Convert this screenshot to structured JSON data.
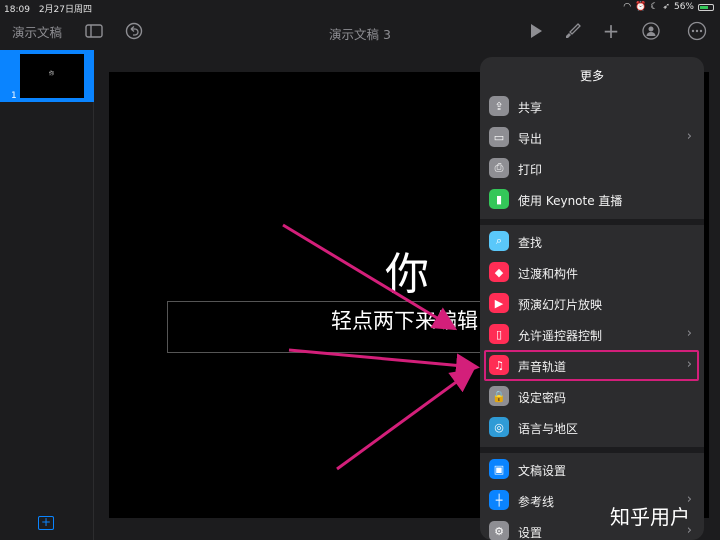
{
  "status_bar": {
    "time": "18:09",
    "date": "2月27日周四",
    "battery": "56%"
  },
  "toolbar": {
    "documents_label": "演示文稿",
    "title": "演示文稿 3"
  },
  "sidebar": {
    "slide_number": "1",
    "thumb_text": "你"
  },
  "slide": {
    "title": "你",
    "subtitle": "轻点两下来编辑"
  },
  "menu": {
    "title": "更多",
    "items": [
      {
        "label": "共享",
        "icon": "share-icon",
        "color": "#8e8e93",
        "glyph": "⇪"
      },
      {
        "label": "导出",
        "icon": "export-icon",
        "color": "#8e8e93",
        "glyph": "▭",
        "chevron": "›"
      },
      {
        "label": "打印",
        "icon": "print-icon",
        "color": "#8e8e93",
        "glyph": "⎙"
      },
      {
        "label": "使用 Keynote 直播",
        "icon": "keynote-live-icon",
        "color": "#34c759",
        "glyph": "▮"
      },
      {
        "label": "查找",
        "icon": "search-icon",
        "color": "#5ac8fa",
        "glyph": "⌕"
      },
      {
        "label": "过渡和构件",
        "icon": "transition-icon",
        "color": "#ff2d55",
        "glyph": "◆"
      },
      {
        "label": "预演幻灯片放映",
        "icon": "rehearse-icon",
        "color": "#ff2d55",
        "glyph": "▶"
      },
      {
        "label": "允许遥控器控制",
        "icon": "remote-icon",
        "color": "#ff2d55",
        "glyph": "▯",
        "chevron": "›"
      },
      {
        "label": "声音轨道",
        "icon": "music-icon",
        "color": "#ff2d55",
        "glyph": "♫",
        "chevron": "›"
      },
      {
        "label": "设定密码",
        "icon": "lock-icon",
        "color": "#8e8e93",
        "glyph": "🔒"
      },
      {
        "label": "语言与地区",
        "icon": "globe-icon",
        "color": "#2f9bd6",
        "glyph": "◎"
      },
      {
        "label": "文稿设置",
        "icon": "document-setup-icon",
        "color": "#0a84ff",
        "glyph": "▣"
      },
      {
        "label": "参考线",
        "icon": "guides-icon",
        "color": "#0a84ff",
        "glyph": "┼",
        "chevron": "›"
      },
      {
        "label": "设置",
        "icon": "gear-icon",
        "color": "#8e8e93",
        "glyph": "⚙",
        "chevron": "›"
      }
    ]
  },
  "watermark": "知乎用户",
  "colors": {
    "accent": "#0a84ff",
    "annotation": "#d31f7a"
  }
}
